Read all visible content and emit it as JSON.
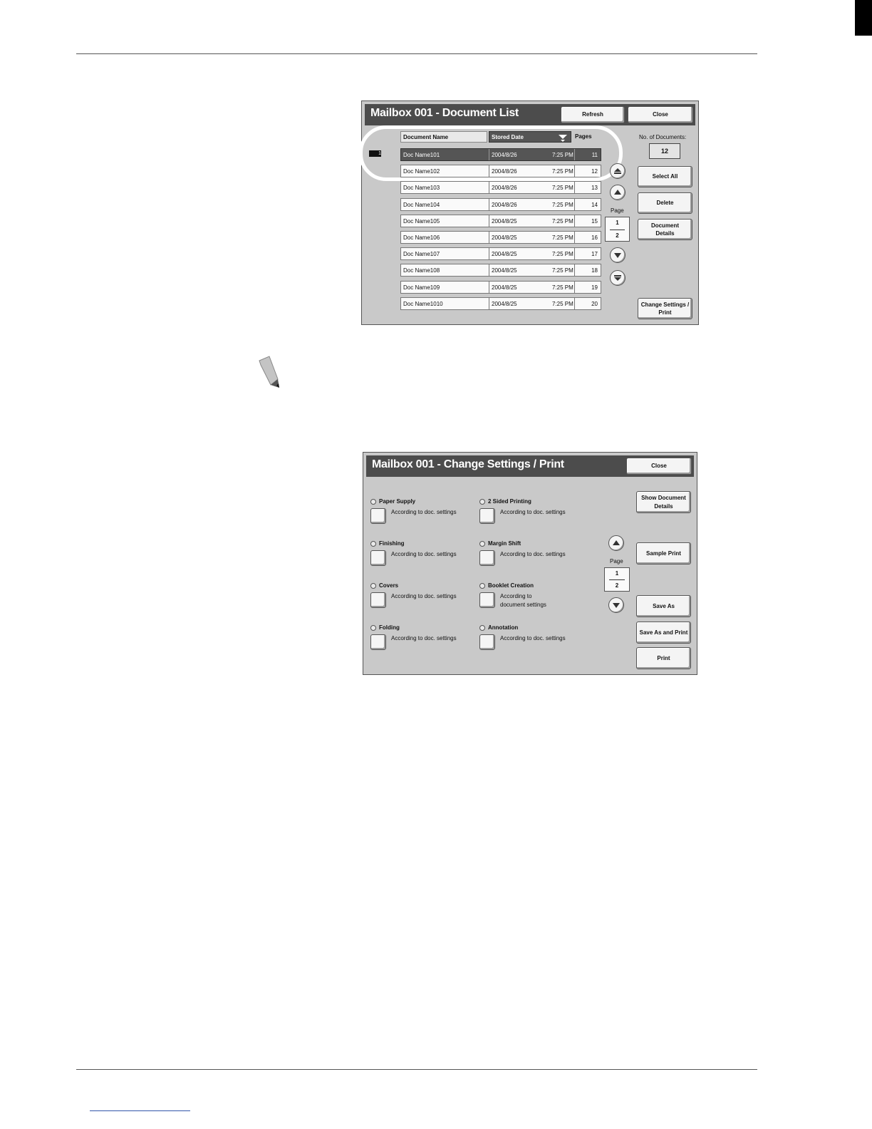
{
  "doc_list": {
    "title": "Mailbox 001 - Document List",
    "refresh_label": "Refresh",
    "close_label": "Close",
    "columns": {
      "name": "Document Name",
      "date": "Stored Date",
      "pages": "Pages"
    },
    "row_marker": "1",
    "rows": [
      {
        "name": "Doc Name101",
        "date": "2004/8/26",
        "time": "7:25 PM",
        "pages": "11"
      },
      {
        "name": "Doc Name102",
        "date": "2004/8/26",
        "time": "7:25 PM",
        "pages": "12"
      },
      {
        "name": "Doc Name103",
        "date": "2004/8/26",
        "time": "7:25 PM",
        "pages": "13"
      },
      {
        "name": "Doc Name104",
        "date": "2004/8/26",
        "time": "7:25 PM",
        "pages": "14"
      },
      {
        "name": "Doc Name105",
        "date": "2004/8/25",
        "time": "7:25 PM",
        "pages": "15"
      },
      {
        "name": "Doc Name106",
        "date": "2004/8/25",
        "time": "7:25 PM",
        "pages": "16"
      },
      {
        "name": "Doc Name107",
        "date": "2004/8/25",
        "time": "7:25 PM",
        "pages": "17"
      },
      {
        "name": "Doc Name108",
        "date": "2004/8/25",
        "time": "7:25 PM",
        "pages": "18"
      },
      {
        "name": "Doc Name109",
        "date": "2004/8/25",
        "time": "7:25 PM",
        "pages": "19"
      },
      {
        "name": "Doc Name1010",
        "date": "2004/8/25",
        "time": "7:25 PM",
        "pages": "20"
      }
    ],
    "page_label": "Page",
    "page_current": "1",
    "page_total": "2",
    "no_of_docs_label": "No. of Documents",
    "no_of_docs_value": "12",
    "select_all_label": "Select All",
    "delete_label": "Delete",
    "document_details_label": "Document\nDetails",
    "change_settings_label": "Change Settings /\nPrint"
  },
  "change_settings": {
    "title": "Mailbox 001 - Change Settings / Print",
    "close_label": "Close",
    "options": [
      {
        "title": "Paper Supply",
        "value": "According to doc. settings"
      },
      {
        "title": "2 Sided Printing",
        "value": "According to doc. settings"
      },
      {
        "title": "Finishing",
        "value": "According to doc. settings"
      },
      {
        "title": "Margin Shift",
        "value": "According to doc. settings"
      },
      {
        "title": "Covers",
        "value": "According to doc. settings"
      },
      {
        "title": "Booklet Creation",
        "value": "According to\ndocument settings"
      },
      {
        "title": "Folding",
        "value": "According to doc. settings"
      },
      {
        "title": "Annotation",
        "value": "According to doc. settings"
      }
    ],
    "page_label": "Page",
    "page_current": "1",
    "page_total": "2",
    "show_doc_details_label": "Show Document\nDetails",
    "sample_print_label": "Sample Print",
    "save_as_label": "Save As",
    "save_as_print_label": "Save As and Print",
    "print_label": "Print"
  }
}
